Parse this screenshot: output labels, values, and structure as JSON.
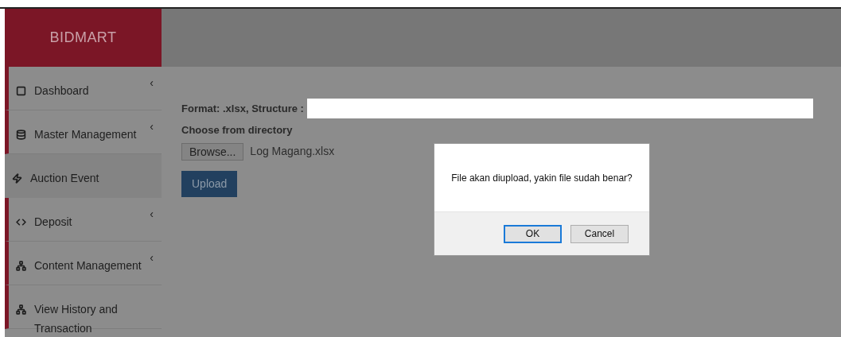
{
  "brand": "BIDMART",
  "sidebar": {
    "items": [
      {
        "label": "Dashboard",
        "selected": false,
        "expandable": true
      },
      {
        "label": "Master Management",
        "selected": false,
        "expandable": true
      },
      {
        "label": "Auction Event",
        "selected": true,
        "expandable": false
      },
      {
        "label": "Deposit",
        "selected": false,
        "expandable": true
      },
      {
        "label": "Content Management",
        "selected": false,
        "expandable": true
      },
      {
        "label": "View History and Transaction",
        "selected": false,
        "expandable": false
      }
    ],
    "caret": "‹"
  },
  "form": {
    "format_label": "Format: .xlsx, Structure :",
    "choose_label": "Choose from directory",
    "browse_button": "Browse...",
    "file_name": "Log Magang.xlsx",
    "upload_button": "Upload"
  },
  "dialog": {
    "message": "File akan diupload, yakin file sudah benar?",
    "buttons": [
      {
        "label": "OK",
        "selected": true
      },
      {
        "label": "Cancel",
        "selected": false
      }
    ]
  }
}
